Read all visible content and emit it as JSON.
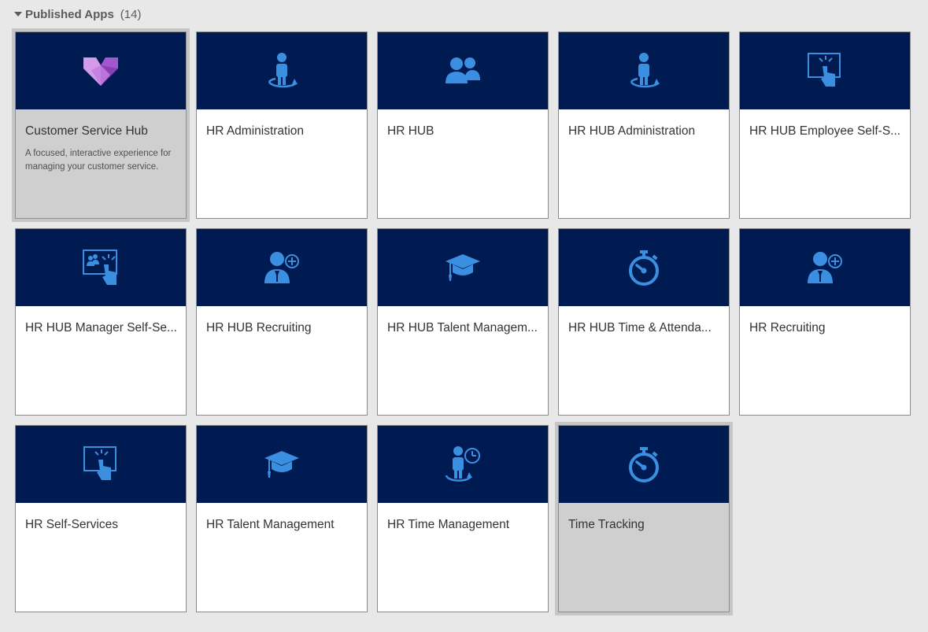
{
  "section": {
    "title": "Published Apps",
    "count": "(14)"
  },
  "apps": [
    {
      "title": "Customer Service Hub",
      "description": "A focused, interactive experience for managing your customer service.",
      "icon": "heart-logo-icon",
      "selected": true
    },
    {
      "title": "HR Administration",
      "icon": "person-admin-icon"
    },
    {
      "title": "HR HUB",
      "icon": "people-icon"
    },
    {
      "title": "HR HUB Administration",
      "icon": "person-admin-icon"
    },
    {
      "title": "HR HUB Employee Self-S...",
      "icon": "touch-screen-icon"
    },
    {
      "title": "HR HUB Manager Self-Se...",
      "icon": "team-touch-screen-icon"
    },
    {
      "title": "HR HUB Recruiting",
      "icon": "person-add-icon"
    },
    {
      "title": "HR HUB Talent Managem...",
      "icon": "graduation-cap-icon"
    },
    {
      "title": "HR HUB Time & Attenda...",
      "icon": "stopwatch-icon"
    },
    {
      "title": "HR Recruiting",
      "icon": "person-add-icon"
    },
    {
      "title": "HR Self-Services",
      "icon": "touch-screen-icon"
    },
    {
      "title": "HR Talent Management",
      "icon": "graduation-cap-icon"
    },
    {
      "title": "HR Time Management",
      "icon": "person-clock-icon"
    },
    {
      "title": "Time Tracking",
      "icon": "stopwatch-icon",
      "selected": true
    }
  ],
  "colors": {
    "banner": "#001a52",
    "icon": "#3b8fe0",
    "selected_tile": "#cfcfcf",
    "background": "#e8e8e8"
  }
}
